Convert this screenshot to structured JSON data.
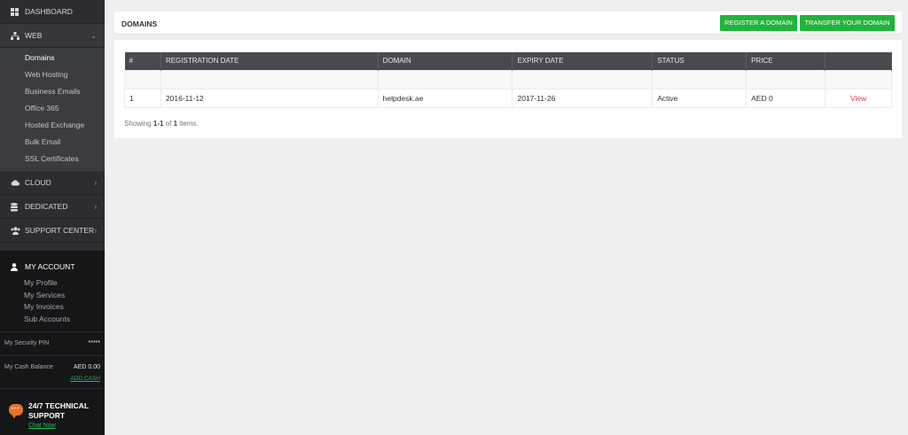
{
  "sidebar": {
    "dashboard": "DASHBOARD",
    "web": "WEB",
    "web_items": [
      "Domains",
      "Web Hosting",
      "Business Emails",
      "Office 365",
      "Hosted Exchange",
      "Bulk Email",
      "SSL Certificates"
    ],
    "cloud": "CLOUD",
    "dedicated": "DEDICATED",
    "support_center": "SUPPORT CENTER",
    "account": {
      "title": "MY ACCOUNT",
      "links": [
        "My Profile",
        "My Services",
        "My Invoices",
        "Sub Accounts"
      ],
      "security_pin_label": "My Security PIN",
      "security_pin_value": "*****",
      "cash_label": "My Cash Balance",
      "cash_value": "AED 0.00",
      "add_cash": "ADD CASH"
    },
    "support": {
      "title_line1": "24/7 TECHNICAL",
      "title_line2": "SUPPORT",
      "chat": "Chat Now"
    }
  },
  "header": {
    "title": "DOMAINS",
    "register_button": "REGISTER A DOMAIN",
    "transfer_button": "TRANSFER YOUR DOMAIN"
  },
  "table": {
    "columns": [
      "#",
      "REGISTRATION DATE",
      "DOMAIN",
      "EXPIRY DATE",
      "STATUS",
      "PRICE",
      ""
    ],
    "rows": [
      [
        "1",
        "2016-11-12",
        "helpdesk.ae",
        "2017-11-26",
        "Active",
        "AED 0",
        "View"
      ]
    ]
  },
  "summary": {
    "prefix": "Showing ",
    "range": "1-1",
    "middle": " of ",
    "total": "1",
    "suffix": " items."
  },
  "colors": {
    "sidebar_bg": "#2b2d30",
    "button_green": "#1fb53a",
    "table_header": "#484a50",
    "view_link": "#d9453c"
  }
}
